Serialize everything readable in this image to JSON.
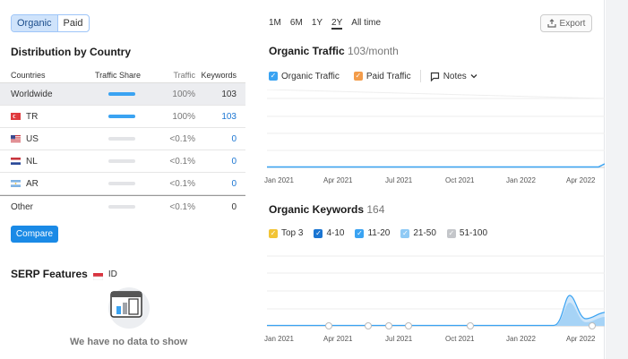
{
  "toggle": {
    "organic": "Organic",
    "paid": "Paid"
  },
  "distribution": {
    "title": "Distribution by Country",
    "columns": [
      "Countries",
      "Traffic Share",
      "Traffic",
      "Keywords"
    ],
    "rows": [
      {
        "country": "Worldwide",
        "flag": "",
        "share": 1.0,
        "traffic": "100%",
        "keywords": "103",
        "link": false
      },
      {
        "country": "TR",
        "flag": "turkey-flag",
        "share": 1.0,
        "traffic": "100%",
        "keywords": "103",
        "link": true
      },
      {
        "country": "US",
        "flag": "us-flag",
        "share": 0.0,
        "traffic": "<0.1%",
        "keywords": "0",
        "link": true
      },
      {
        "country": "NL",
        "flag": "netherlands-flag",
        "share": 0.0,
        "traffic": "<0.1%",
        "keywords": "0",
        "link": true
      },
      {
        "country": "AR",
        "flag": "argentina-flag",
        "share": 0.0,
        "traffic": "<0.1%",
        "keywords": "0",
        "link": true
      },
      {
        "country": "Other",
        "flag": "",
        "share": 0.0,
        "traffic": "<0.1%",
        "keywords": "0",
        "link": false
      }
    ],
    "compare_label": "Compare"
  },
  "serp": {
    "title": "SERP Features",
    "country": "ID",
    "empty_text": "We have no data to show"
  },
  "periods": [
    "1M",
    "6M",
    "1Y",
    "2Y",
    "All time"
  ],
  "active_period": "2Y",
  "export_label": "Export",
  "organic_traffic": {
    "title": "Organic Traffic",
    "value": "103/month",
    "legend": {
      "organic": "Organic Traffic",
      "paid": "Paid Traffic",
      "notes": "Notes"
    },
    "x_labels": [
      "Jan 2021",
      "Apr 2021",
      "Jul 2021",
      "Oct 2021",
      "Jan 2022",
      "Apr 2022"
    ]
  },
  "organic_keywords": {
    "title": "Organic Keywords",
    "value": "164",
    "legend": [
      "Top 3",
      "4-10",
      "11-20",
      "21-50",
      "51-100"
    ],
    "x_labels": [
      "Jan 2021",
      "Apr 2021",
      "Jul 2021",
      "Oct 2021",
      "Jan 2022",
      "Apr 2022"
    ]
  },
  "colors": {
    "accent": "#1a8ae6",
    "organic": "#3aa3f2",
    "paid": "#f39c4a",
    "top3": "#f2c436",
    "k410": "#1a75d2",
    "k1120": "#3aa3f2",
    "k2150": "#8fcaf5",
    "k51100": "#c4c6ca"
  }
}
